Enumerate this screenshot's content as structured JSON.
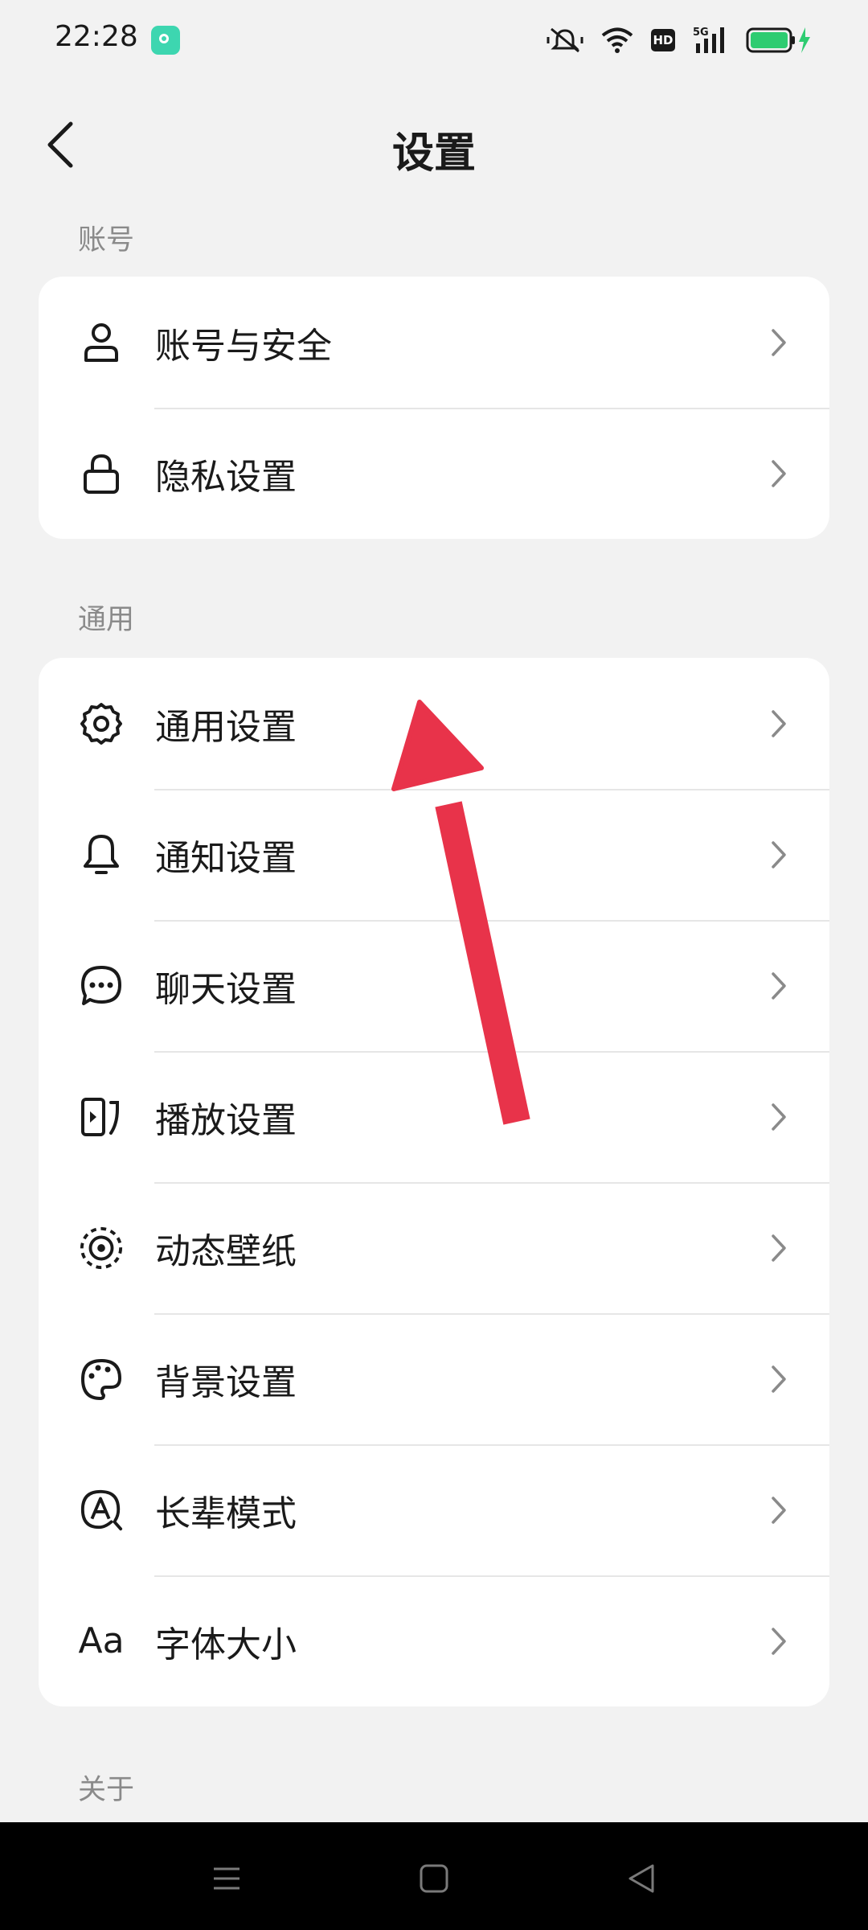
{
  "status_bar": {
    "time": "22:28",
    "icons": [
      "app-notification-icon",
      "mute-icon",
      "wifi-icon",
      "hd-badge",
      "5g-signal-icon",
      "battery-charging-icon"
    ],
    "hd_label": "HD",
    "network_label": "5G",
    "battery_color": "#2ecc71"
  },
  "header": {
    "title": "设置",
    "back_icon": "back-chevron-icon"
  },
  "sections": [
    {
      "label": "账号",
      "items": [
        {
          "label": "账号与安全",
          "icon": "user-icon"
        },
        {
          "label": "隐私设置",
          "icon": "lock-icon"
        }
      ]
    },
    {
      "label": "通用",
      "items": [
        {
          "label": "通用设置",
          "icon": "gear-icon"
        },
        {
          "label": "通知设置",
          "icon": "bell-icon"
        },
        {
          "label": "聊天设置",
          "icon": "chat-bubble-icon"
        },
        {
          "label": "播放设置",
          "icon": "play-screen-icon"
        },
        {
          "label": "动态壁纸",
          "icon": "live-wallpaper-icon"
        },
        {
          "label": "背景设置",
          "icon": "palette-icon"
        },
        {
          "label": "长辈模式",
          "icon": "elder-mode-icon"
        },
        {
          "label": "字体大小",
          "icon": "font-size-icon",
          "icon_text": "Aa"
        }
      ]
    },
    {
      "label": "关于",
      "items": []
    }
  ],
  "annotation": {
    "arrow_color": "#e8334a"
  },
  "nav_bar": {
    "buttons": [
      "menu-icon",
      "home-square-icon",
      "back-triangle-icon"
    ]
  }
}
